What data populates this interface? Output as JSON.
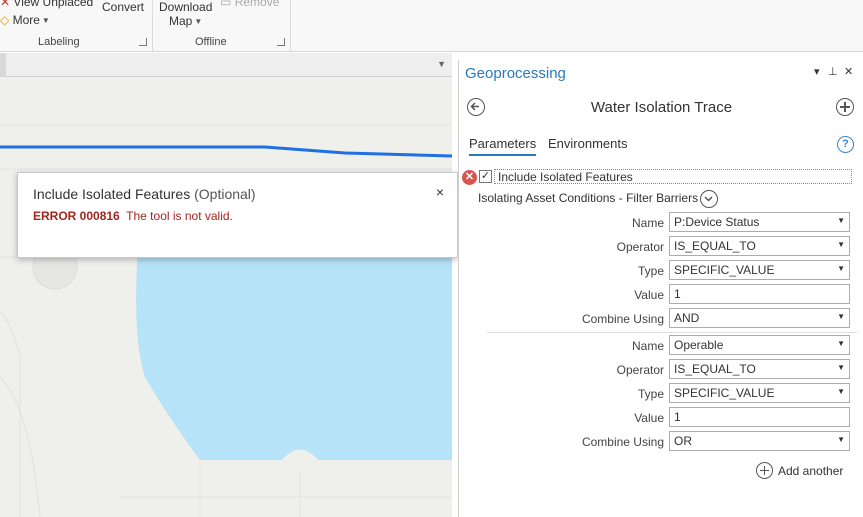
{
  "ribbon": {
    "view_unplaced_label": "View Unplaced",
    "more_label": "More",
    "convert_label": "Convert",
    "download_label": "Download",
    "map_label": "Map",
    "remove_label": "Remove",
    "labeling_group": "Labeling",
    "offline_group": "Offline"
  },
  "popup": {
    "title": "Include Isolated Features",
    "optional": "(Optional)",
    "close_glyph": "×",
    "error_code": "ERROR 000816",
    "error_message": "The tool is not valid."
  },
  "gp": {
    "title": "Geoprocessing",
    "header_menu_glyph": "▾",
    "header_pin_glyph": "⊥",
    "header_close_glyph": "✕",
    "tool_name": "Water Isolation Trace",
    "tabs": {
      "parameters": "Parameters",
      "environments": "Environments"
    },
    "help_glyph": "?",
    "include_isolated": {
      "label": "Include Isolated Features",
      "checked_glyph": "✓",
      "error_glyph": "✕"
    },
    "section_title": "Isolating Asset Conditions - Filter Barriers",
    "conditions": [
      {
        "name_label": "Name",
        "name": "P:Device Status",
        "operator_label": "Operator",
        "operator": "IS_EQUAL_TO",
        "type_label": "Type",
        "type": "SPECIFIC_VALUE",
        "value_label": "Value",
        "value": "1",
        "combine_label": "Combine Using",
        "combine": "AND"
      },
      {
        "name_label": "Name",
        "name": "Operable",
        "operator_label": "Operator",
        "operator": "IS_EQUAL_TO",
        "type_label": "Type",
        "type": "SPECIFIC_VALUE",
        "value_label": "Value",
        "value": "1",
        "combine_label": "Combine Using",
        "combine": "OR"
      }
    ],
    "add_another": "Add another",
    "select_arrow": "▼"
  },
  "colors": {
    "accent": "#2a7ab8",
    "error": "#a4261d",
    "water": "#b7e3f9",
    "trace_line": "#1f6fe5"
  }
}
